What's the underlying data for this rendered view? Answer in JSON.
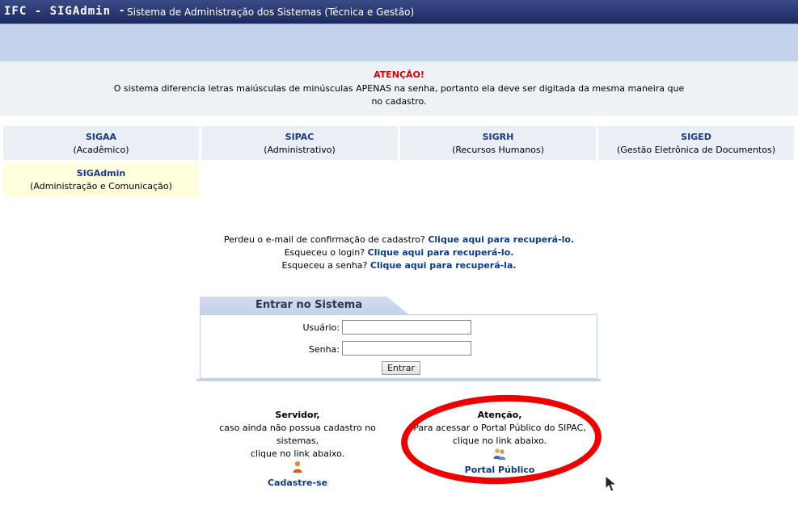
{
  "header": {
    "system": "IFC - SIGAdmin",
    "separator": "-",
    "description": "Sistema de Administração dos Sistemas (Técnica e Gestão)"
  },
  "notice": {
    "title": "ATENÇÃO!",
    "message": "O sistema diferencia letras maiúsculas de minúsculas APENAS na senha, portanto ela deve ser digitada da mesma maneira que no cadastro."
  },
  "systems": [
    {
      "name": "SIGAA",
      "desc": "(Acadêmico)"
    },
    {
      "name": "SIPAC",
      "desc": "(Administrativo)"
    },
    {
      "name": "SIGRH",
      "desc": "(Recursos Humanos)"
    },
    {
      "name": "SIGED",
      "desc": "(Gestão Eletrônica de Documentos)"
    },
    {
      "name": "SIGAdmin",
      "desc": "(Administração e Comunicação)"
    }
  ],
  "recovery": {
    "email_text": "Perdeu o e-mail de confirmação de cadastro?",
    "email_link": "Clique aqui para recuperá-lo.",
    "login_text": "Esqueceu o login?",
    "login_link": "Clique aqui para recuperá-lo.",
    "password_text": "Esqueceu a senha?",
    "password_link": "Clique aqui para recuperá-la."
  },
  "login": {
    "title": "Entrar no Sistema",
    "user_label": "Usuário:",
    "user_value": "",
    "password_label": "Senha:",
    "password_value": "",
    "submit": "Entrar"
  },
  "server": {
    "title": "Servidor,",
    "line1": "caso ainda não possua cadastro no sistemas,",
    "line2": "clique no link abaixo.",
    "link": "Cadastre-se"
  },
  "portal": {
    "title": "Atenção,",
    "line1": "Para acessar o Portal Público do SIPAC,",
    "line2": "clique no link abaixo.",
    "link": "Portal Público"
  },
  "colors": {
    "header": "#1c2a60",
    "alert": "#d40000",
    "link": "#0c3a88",
    "annotation": "#ee0000"
  }
}
